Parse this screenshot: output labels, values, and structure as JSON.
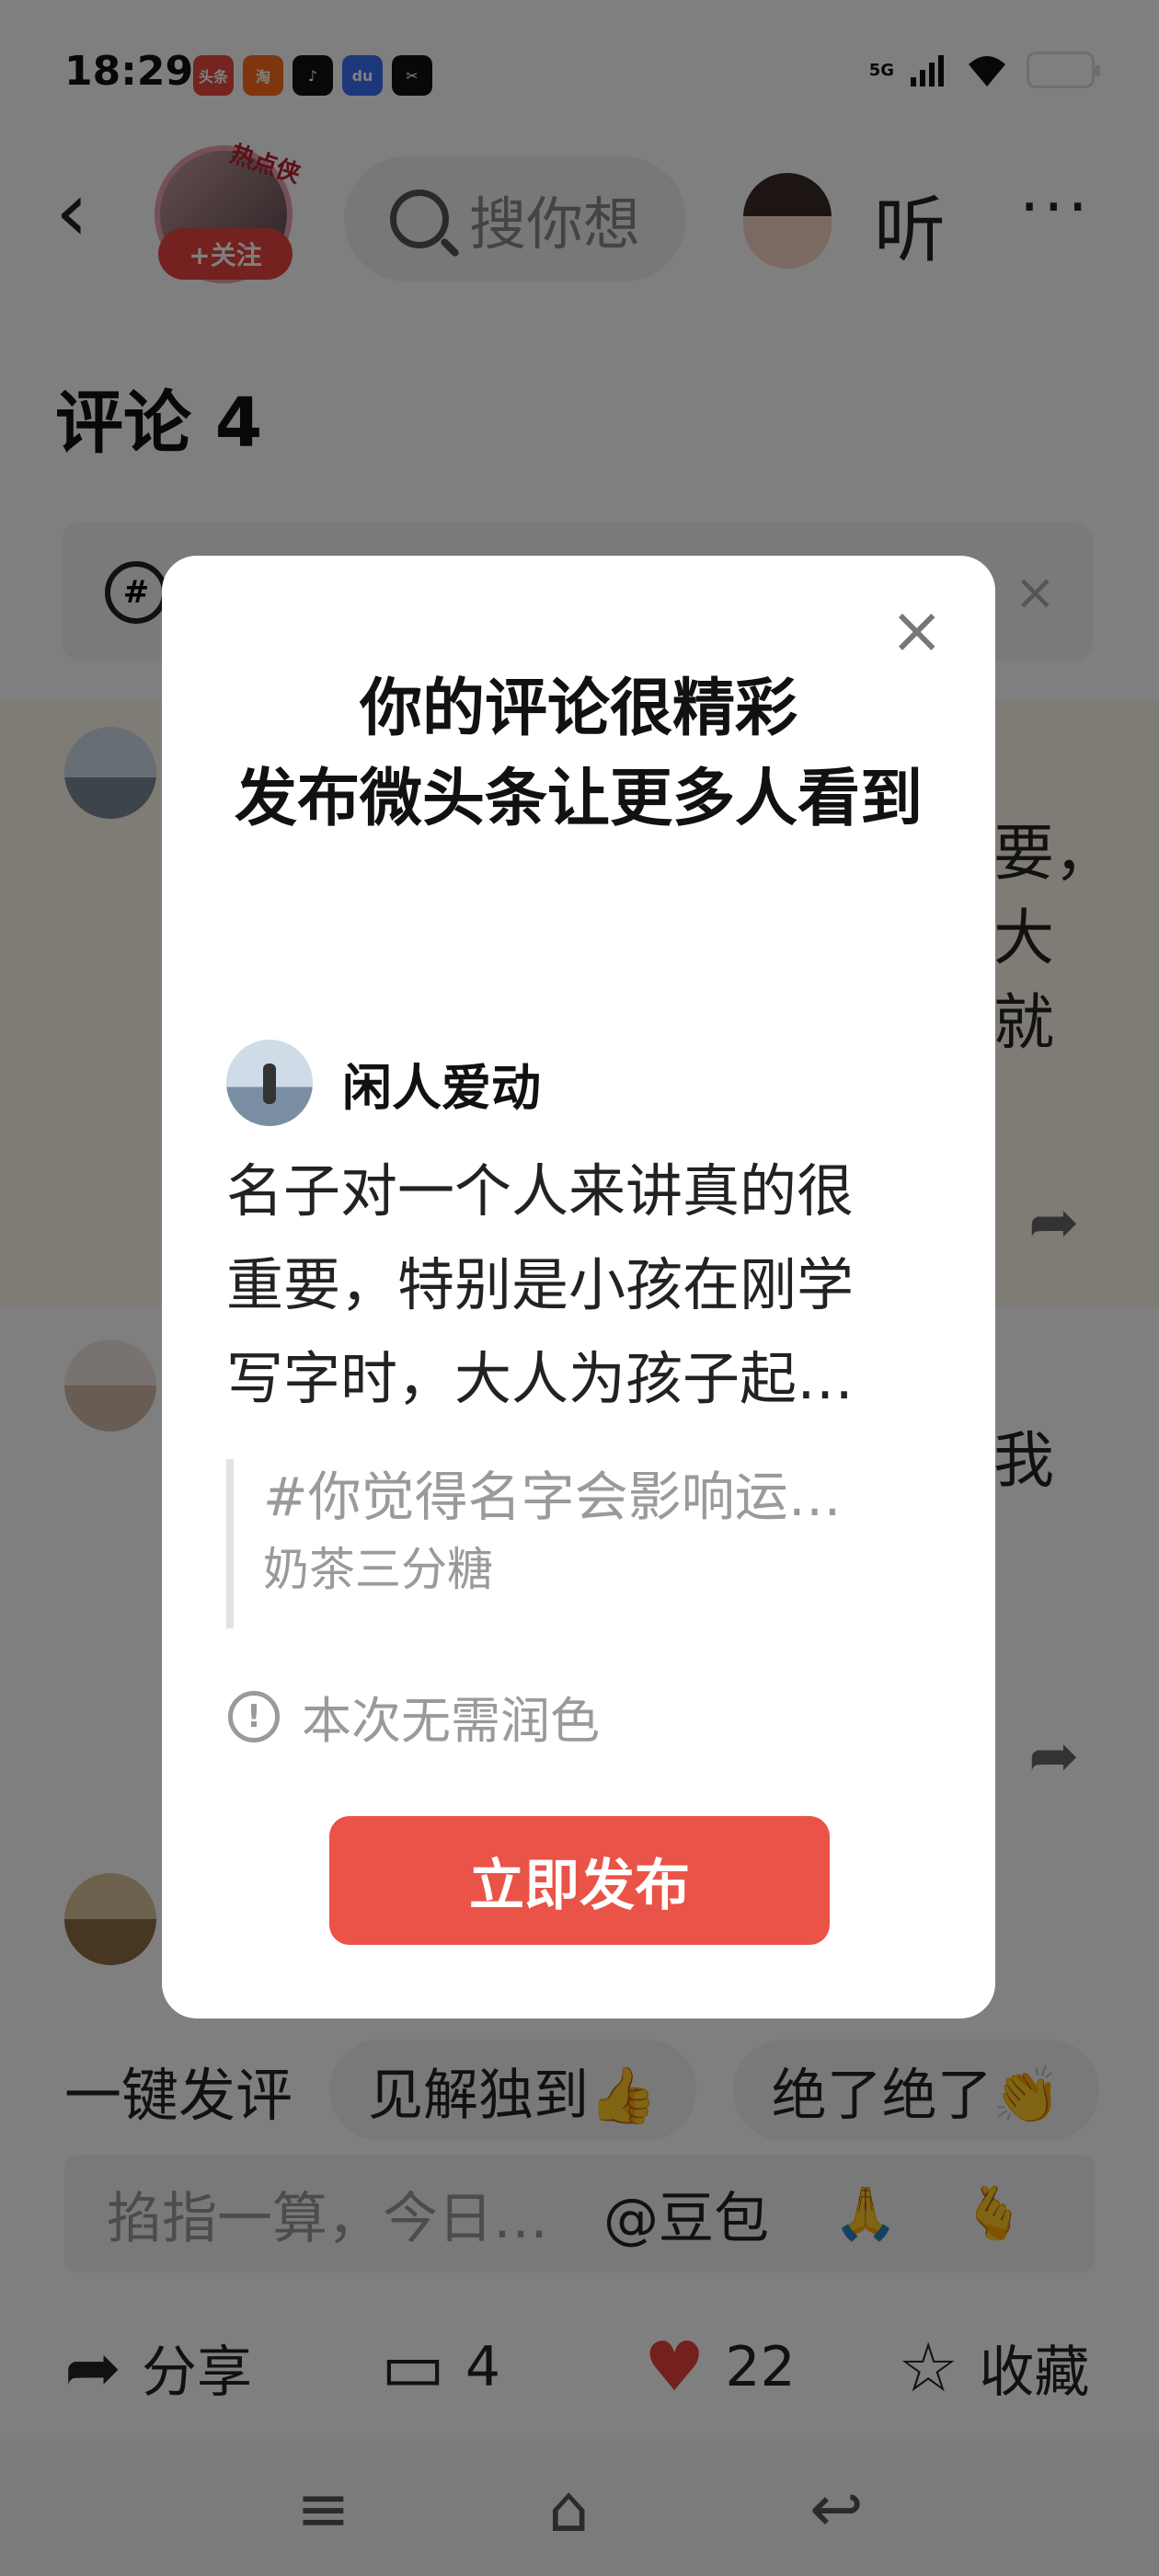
{
  "status_bar": {
    "time": "18:29",
    "network": "5G",
    "apps": [
      {
        "name": "toutiao-icon",
        "label": "头条",
        "color": "#e84a3f"
      },
      {
        "name": "taobao-icon",
        "label": "淘",
        "color": "#ff6a1a"
      },
      {
        "name": "douyin-icon",
        "label": "♪",
        "color": "#111111"
      },
      {
        "name": "baidu-icon",
        "label": "du",
        "color": "#3b6ef6"
      },
      {
        "name": "capcut-icon",
        "label": "✂",
        "color": "#111111"
      }
    ]
  },
  "header": {
    "back_icon": "‹",
    "hot_tag": "热点侠",
    "follow_label": "+关注",
    "search_placeholder": "搜你想",
    "listen_label": "听",
    "more_icon": "···"
  },
  "comments": {
    "title": "评论 4",
    "partial_texts": [
      "要，",
      "大",
      "就",
      "我"
    ]
  },
  "modal": {
    "close_icon": "×",
    "title_line1": "你的评论很精彩",
    "title_line2": "发布微头条让更多人看到",
    "username": "闲人爱动",
    "comment_text": "名子对一个人来讲真的很重要，特别是小孩在刚学写字时，大人为孩子起…",
    "quote_topic": "#你觉得名字会影响运…",
    "quote_author": "奶茶三分糖",
    "notice": "本次无需润色",
    "publish_label": "立即发布"
  },
  "quick_reply": {
    "label": "一键发评",
    "chips": [
      "见解独到👍",
      "绝了绝了👏"
    ]
  },
  "compose": {
    "placeholder": "掐指一算，今日…",
    "mention": "@豆包"
  },
  "action_bar": {
    "share_label": "分享",
    "comment_count": "4",
    "like_count": "22",
    "favorite_label": "收藏"
  }
}
